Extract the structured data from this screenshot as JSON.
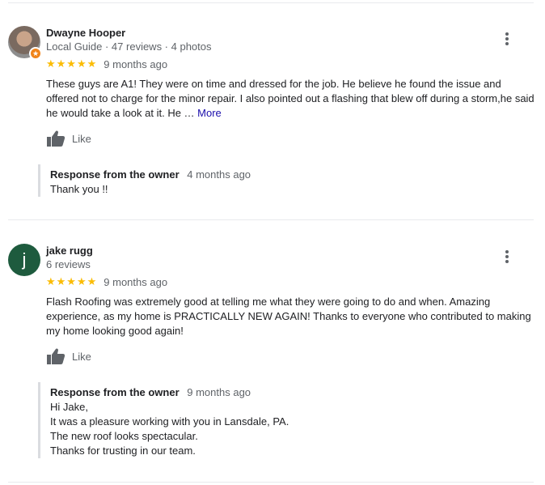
{
  "reviews": [
    {
      "name": "Dwayne Hooper",
      "meta": "Local Guide · 47 reviews · 4 photos",
      "stars": "★★★★★",
      "rating": 5,
      "time": "9 months ago",
      "text": "These guys are A1! They were on time and dressed for the job. He believe he found the issue and offered not to charge for the minor repair. I also pointed out a flashing that blew off during a storm,he said he would take a look at it. He …",
      "more_label": "More",
      "like_label": "Like",
      "response": {
        "title": "Response from the owner",
        "time": "4 months ago",
        "lines": [
          "Thank you !!"
        ]
      }
    },
    {
      "name": "jake rugg",
      "avatar_letter": "j",
      "avatar_color": "#1e5b3e",
      "meta": "6 reviews",
      "stars": "★★★★★",
      "rating": 5,
      "time": "9 months ago",
      "text": "Flash Roofing was extremely  good at telling me what they were going to do and when. Amazing experience, as my home is PRACTICALLY NEW AGAIN! Thanks to everyone who contributed to making my home looking good again!",
      "like_label": "Like",
      "response": {
        "title": "Response from the owner",
        "time": "9 months ago",
        "lines": [
          "Hi Jake,",
          "It was a pleasure working with you in Lansdale, PA.",
          "The new roof looks spectacular.",
          "Thanks for trusting in our team."
        ]
      }
    }
  ],
  "colors": {
    "star": "#fbbc04",
    "link": "#1a0dab",
    "guide_badge": "#f0841a"
  }
}
